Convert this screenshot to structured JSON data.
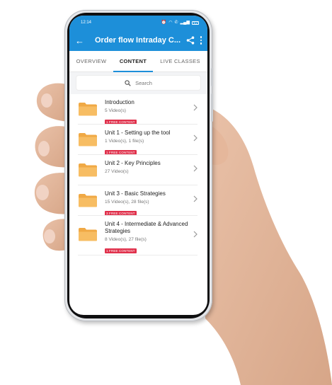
{
  "status_bar": {
    "time": "12:14",
    "battery_level": "37"
  },
  "app_bar": {
    "title": "Order flow Intraday C..."
  },
  "tabs": [
    {
      "label": "OVERVIEW",
      "active": false
    },
    {
      "label": "CONTENT",
      "active": true
    },
    {
      "label": "LIVE CLASSES",
      "active": false
    }
  ],
  "search": {
    "placeholder": "Search"
  },
  "units": [
    {
      "title": "Introduction",
      "meta": "5 Video(s)",
      "badge": "1 FREE CONTENT"
    },
    {
      "title": "Unit 1 - Setting up the tool",
      "meta": "1 Video(s), 1 file(s)",
      "badge": "1 FREE CONTENT"
    },
    {
      "title": "Unit 2 - Key Principles",
      "meta": "27 Video(s)",
      "badge": ""
    },
    {
      "title": "Unit 3 - Basic Strategies",
      "meta": "15 Video(s), 28 file(s)",
      "badge": "3 FREE CONTENT"
    },
    {
      "title": "Unit 4 - Intermediate & Advanced Strategies",
      "meta": "8 Video(s), 27 file(s)",
      "badge": "1 FREE CONTENT"
    }
  ],
  "colors": {
    "primary": "#1d8fd9",
    "badge": "#e0304b",
    "folder": "#f5b45a"
  }
}
